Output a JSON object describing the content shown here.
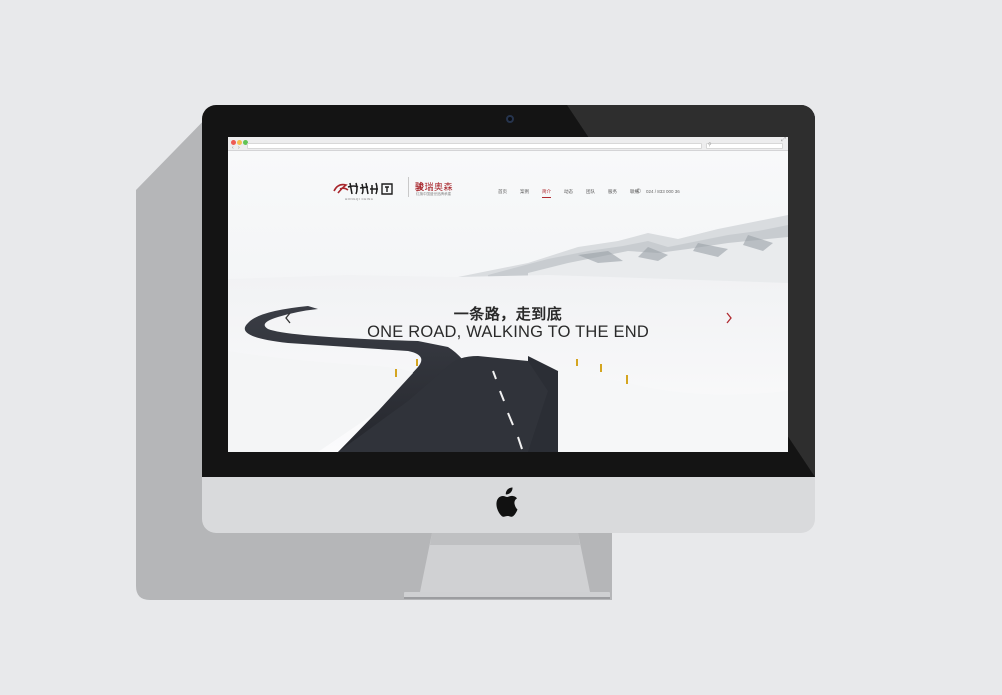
{
  "mockup": {
    "device": "desktop-monitor",
    "logo_icon": "apple-logo-icon",
    "camera_icon": "camera-icon"
  },
  "browser": {
    "traffic_lights": [
      "#ee5a52",
      "#f5bf4f",
      "#61c454"
    ],
    "back_icon": "back-arrow-icon",
    "forward_icon": "forward-arrow-icon",
    "address": "",
    "search_placeholder": "",
    "search_icon": "search-icon"
  },
  "site": {
    "brand": {
      "script_logo_icon": "hongqi-calligraphy-logo-icon",
      "script_sub": "HONGQI CHINA",
      "partner_name": "瑞奥森",
      "partner_mark": "骏",
      "partner_sub": "红旗中国盛世品牌承建"
    },
    "nav": [
      {
        "label": "首页",
        "active": false
      },
      {
        "label": "案例",
        "active": false
      },
      {
        "label": "简介",
        "active": true
      },
      {
        "label": "动态",
        "active": false
      },
      {
        "label": "团队",
        "active": false
      },
      {
        "label": "服务",
        "active": false
      },
      {
        "label": "联络",
        "active": false
      }
    ],
    "phone": {
      "icon": "phone-icon",
      "number": "024 / 833 000 36"
    },
    "hero": {
      "headline_cn": "一条路，走到底",
      "headline_en": "ONE ROAD, WALKING TO THE END",
      "prev_icon": "chevron-left-icon",
      "next_icon": "chevron-right-icon",
      "slides_count": 3,
      "active_slide": 1
    }
  },
  "colors": {
    "accent": "#b02a30",
    "bezel": "#141414",
    "chin": "#d9dadc",
    "background": "#e8e9eb",
    "shadow": "#b4b5b7"
  }
}
